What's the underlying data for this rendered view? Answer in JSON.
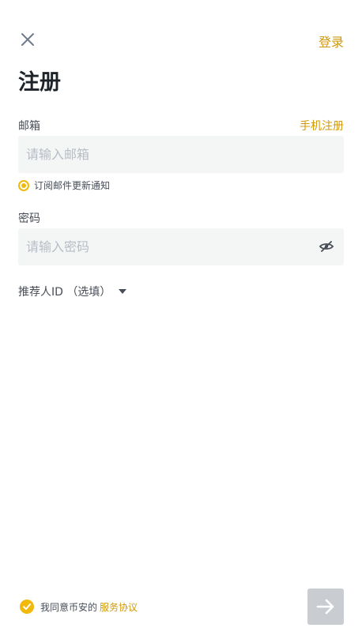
{
  "header": {
    "close_icon": "close-icon",
    "login_label": "登录"
  },
  "page": {
    "title": "注册"
  },
  "email": {
    "label": "邮箱",
    "switch_label": "手机注册",
    "placeholder": "请输入邮箱",
    "value": ""
  },
  "subscribe": {
    "label": "订阅邮件更新通知",
    "checked": true
  },
  "password": {
    "label": "密码",
    "placeholder": "请输入密码",
    "value": "",
    "toggle_icon": "eye-hidden-icon"
  },
  "referral": {
    "label": "推荐人ID （选填）",
    "icon": "caret-down-icon"
  },
  "agreement": {
    "checked": true,
    "text": "我同意币安的",
    "link_label": "服务协议"
  },
  "submit": {
    "icon": "arrow-right-icon",
    "enabled": false
  },
  "colors": {
    "accent": "#f0b90b",
    "link": "#d0980b",
    "input_bg": "#f4f5f5",
    "disabled_button": "#c9cdd2"
  }
}
